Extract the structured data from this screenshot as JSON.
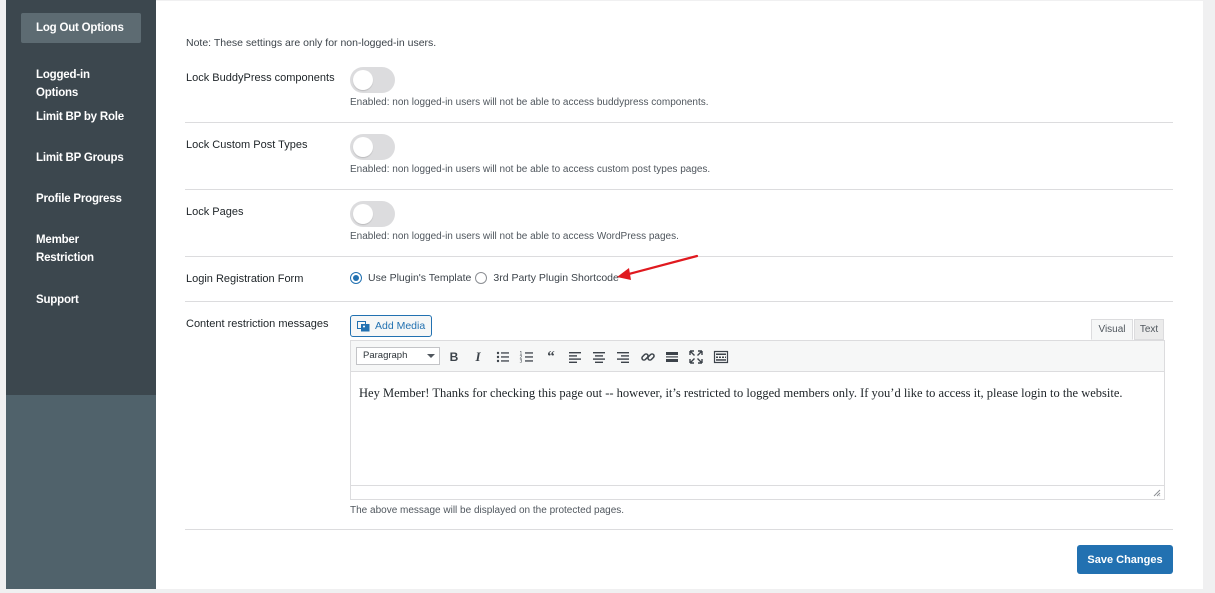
{
  "sidebar": {
    "items": [
      {
        "label": "Log Out Options"
      },
      {
        "label": "Logged-in Options"
      },
      {
        "label": "Limit BP by Role"
      },
      {
        "label": "Limit BP Groups"
      },
      {
        "label": "Profile Progress"
      },
      {
        "label": "Member\nRestriction"
      },
      {
        "label": "Support"
      }
    ],
    "active_index": 0
  },
  "main": {
    "note": "Note: These settings are only for non-logged-in users.",
    "settings": [
      {
        "label": "Lock BuddyPress components",
        "enabled": false,
        "description": "Enabled: non logged-in users will not be able to access buddypress components."
      },
      {
        "label": "Lock Custom Post Types",
        "enabled": false,
        "description": "Enabled: non logged-in users will not be able to access custom post types pages."
      },
      {
        "label": "Lock Pages",
        "enabled": false,
        "description": "Enabled: non logged-in users will not be able to access WordPress pages."
      }
    ],
    "login_form": {
      "label": "Login Registration Form",
      "options": [
        {
          "label": "Use Plugin's Template",
          "checked": true
        },
        {
          "label": "3rd Party Plugin Shortcode",
          "checked": false
        }
      ]
    },
    "content_restriction": {
      "label": "Content restriction messages",
      "add_media_label": "Add Media",
      "tabs": {
        "visual": "Visual",
        "text": "Text",
        "active": "visual"
      },
      "format_select": "Paragraph",
      "toolbar_icons": [
        "bold-icon",
        "italic-icon",
        "bulleted-list-icon",
        "numbered-list-icon",
        "blockquote-icon",
        "align-left-icon",
        "align-center-icon",
        "align-right-icon",
        "link-icon",
        "read-more-icon",
        "fullscreen-icon",
        "toolbar-toggle-icon"
      ],
      "message": "Hey Member! Thanks for checking this page out -- however, it’s restricted to logged members only. If you’d like to access it, please login to the website.",
      "help": "The above message will be displayed on the protected pages."
    },
    "save_label": "Save Changes"
  },
  "colors": {
    "accent": "#2271b1",
    "sidebar_dark": "#3c474e",
    "sidebar_light": "#50626b",
    "annotation_arrow": "#e0191f"
  }
}
